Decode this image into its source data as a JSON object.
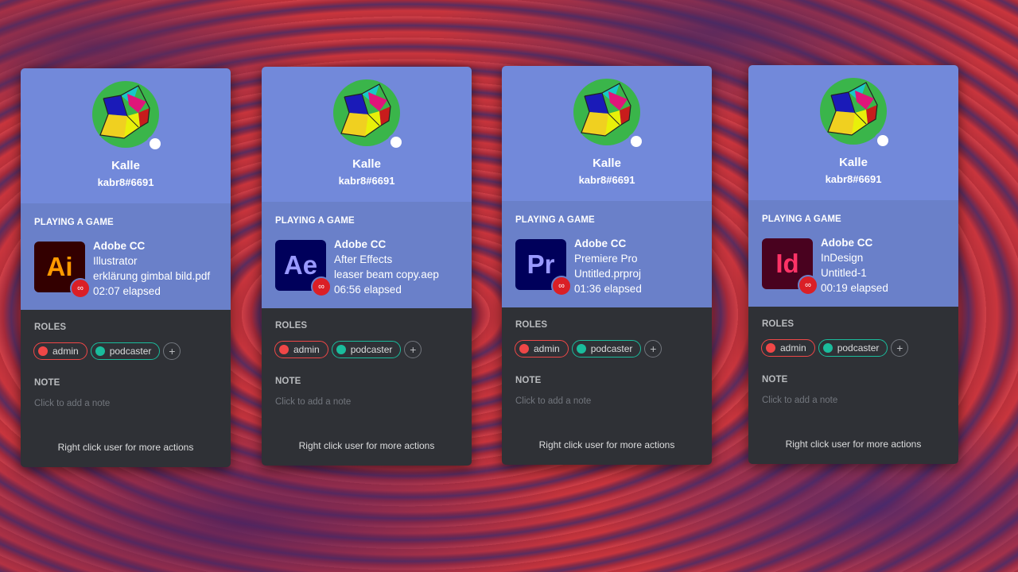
{
  "colors": {
    "accent": "#7289da",
    "activity_bg": "#6a80c9",
    "panel_bg": "#2f3136",
    "status_online": "#ffffff",
    "cc_badge": "#da1f26"
  },
  "cards": [
    {
      "username": "Kalle",
      "tag": "kabr8#6691",
      "activity_label": "PLAYING A GAME",
      "app_abbr": "Ai",
      "app_bg": "#330000",
      "app_fg": "#ff9a00",
      "app_name": "Adobe CC",
      "details": "Illustrator",
      "state": "erklärung gimbal bild.pdf",
      "elapsed": "02:07 elapsed",
      "roles_label": "ROLES",
      "roles": [
        {
          "name": "admin",
          "color": "#f04747"
        },
        {
          "name": "podcaster",
          "color": "#1abc9c"
        }
      ],
      "note_label": "NOTE",
      "note_placeholder": "Click to add a note",
      "footer": "Right click user for more actions"
    },
    {
      "username": "Kalle",
      "tag": "kabr8#6691",
      "activity_label": "PLAYING A GAME",
      "app_abbr": "Ae",
      "app_bg": "#00005b",
      "app_fg": "#9999ff",
      "app_name": "Adobe CC",
      "details": "After Effects",
      "state": "leaser beam copy.aep",
      "elapsed": "06:56 elapsed",
      "roles_label": "ROLES",
      "roles": [
        {
          "name": "admin",
          "color": "#f04747"
        },
        {
          "name": "podcaster",
          "color": "#1abc9c"
        }
      ],
      "note_label": "NOTE",
      "note_placeholder": "Click to add a note",
      "footer": "Right click user for more actions"
    },
    {
      "username": "Kalle",
      "tag": "kabr8#6691",
      "activity_label": "PLAYING A GAME",
      "app_abbr": "Pr",
      "app_bg": "#00005b",
      "app_fg": "#9999ff",
      "app_name": "Adobe CC",
      "details": "Premiere Pro",
      "state": "Untitled.prproj",
      "elapsed": "01:36 elapsed",
      "roles_label": "ROLES",
      "roles": [
        {
          "name": "admin",
          "color": "#f04747"
        },
        {
          "name": "podcaster",
          "color": "#1abc9c"
        }
      ],
      "note_label": "NOTE",
      "note_placeholder": "Click to add a note",
      "footer": "Right click user for more actions"
    },
    {
      "username": "Kalle",
      "tag": "kabr8#6691",
      "activity_label": "PLAYING A GAME",
      "app_abbr": "Id",
      "app_bg": "#49021f",
      "app_fg": "#ff3366",
      "app_name": "Adobe CC",
      "details": "InDesign",
      "state": "Untitled-1",
      "elapsed": "00:19 elapsed",
      "roles_label": "ROLES",
      "roles": [
        {
          "name": "admin",
          "color": "#f04747"
        },
        {
          "name": "podcaster",
          "color": "#1abc9c"
        }
      ],
      "note_label": "NOTE",
      "note_placeholder": "Click to add a note",
      "footer": "Right click user for more actions"
    }
  ]
}
